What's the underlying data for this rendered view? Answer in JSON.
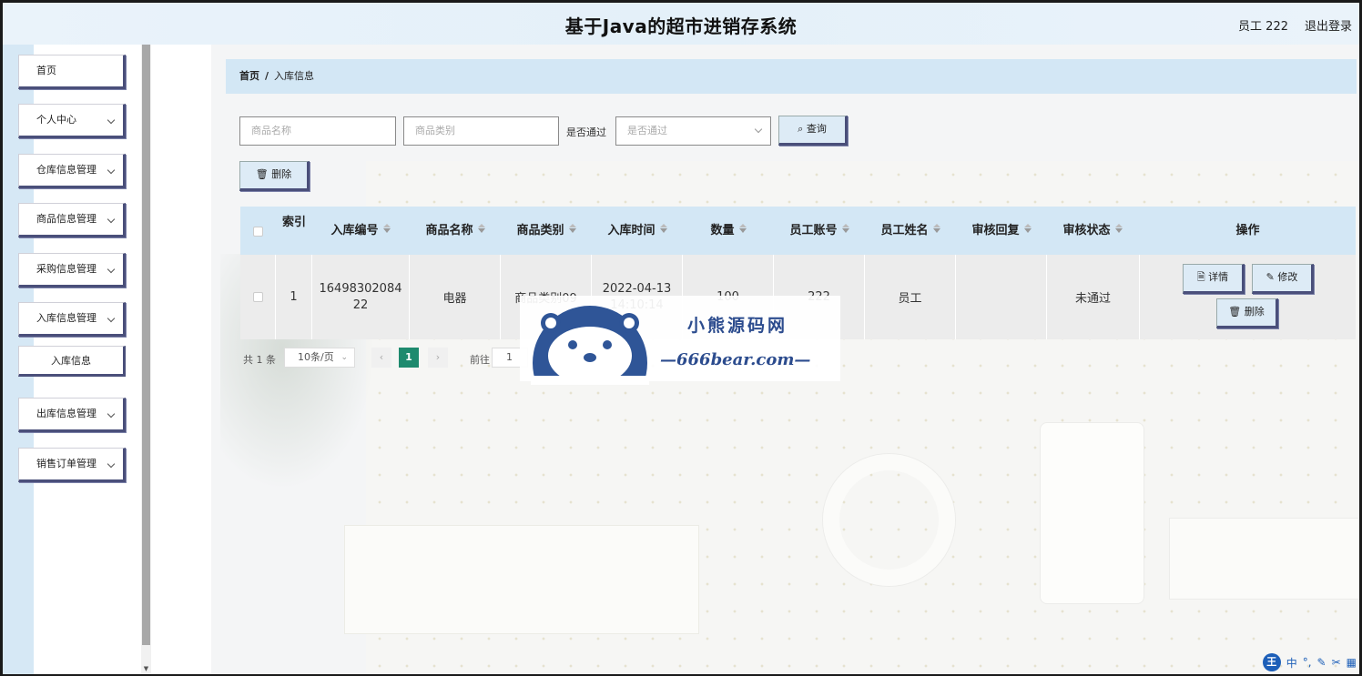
{
  "header": {
    "title": "基于Java的超市进销存系统",
    "user": "员工 222",
    "logout": "退出登录"
  },
  "sidebar": {
    "items": [
      {
        "label": "首页",
        "expandable": false
      },
      {
        "label": "个人中心",
        "expandable": true
      },
      {
        "label": "仓库信息管理",
        "expandable": true
      },
      {
        "label": "商品信息管理",
        "expandable": true
      },
      {
        "label": "采购信息管理",
        "expandable": true
      },
      {
        "label": "入库信息管理",
        "expandable": true
      },
      {
        "label": "入库信息",
        "expandable": false
      },
      {
        "label": "出库信息管理",
        "expandable": true
      },
      {
        "label": "销售订单管理",
        "expandable": true
      }
    ]
  },
  "breadcrumb": {
    "home": "首页",
    "separator": "/",
    "current": "入库信息"
  },
  "filters": {
    "name_placeholder": "商品名称",
    "category_placeholder": "商品类别",
    "pass_label": "是否通过",
    "pass_placeholder": "是否通过",
    "search_label": "查询"
  },
  "toolbar": {
    "delete_label": "删除"
  },
  "table": {
    "columns": [
      "索引",
      "入库编号",
      "商品名称",
      "商品类别",
      "入库时间",
      "数量",
      "员工账号",
      "员工姓名",
      "审核回复",
      "审核状态",
      "操作"
    ],
    "rows": [
      {
        "index": "1",
        "code": "1649830208422",
        "name": "电器",
        "category": "商品类别09",
        "time": "2022-04-13 14:10:14",
        "qty": "100",
        "account": "222",
        "staff": "员工",
        "reply": "",
        "status": "未通过"
      }
    ],
    "actions": {
      "detail": "详情",
      "edit": "修改",
      "delete": "删除"
    }
  },
  "pagination": {
    "total": "共 1 条",
    "page_size": "10条/页",
    "current_page": "1",
    "goto_label": "前往",
    "goto_value": "1"
  },
  "watermark": {
    "title": "小熊源码网",
    "url": "—666bear.com—"
  },
  "tray": {
    "lang": "中"
  }
}
